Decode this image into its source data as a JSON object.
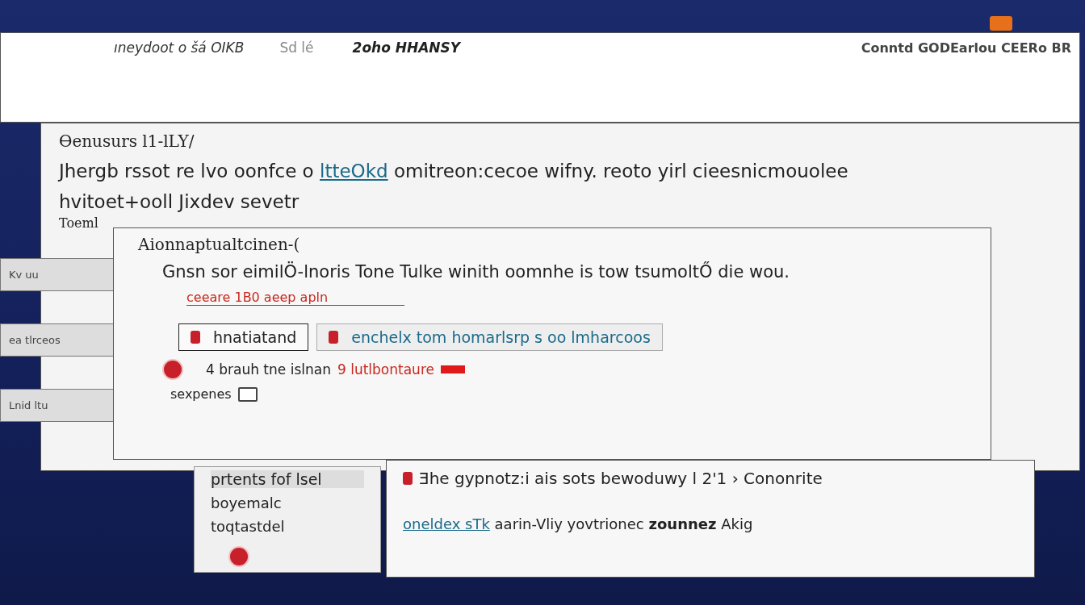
{
  "top_window": {
    "title": "ıneydoot o šá OIKB",
    "tabs": [
      {
        "label": "Sd lé",
        "selected": false
      },
      {
        "label": "2oho HHANSY",
        "selected": true
      }
    ],
    "right_text": "Conntd GODEarlou CEERo BR"
  },
  "main_window": {
    "heading": "Ɵenusurs l1-lLY/",
    "line_1_before": "Jhergb rssot re lvo oonfce o",
    "line_1_link": "ltteOkd",
    "line_1_after": "omitreon:cecoe wifny. reoto yirl cieesnicmouolee",
    "line_2": "hvitoet+ooll Jixdev sevetr",
    "line_3": "Toeml"
  },
  "dialog": {
    "title": "Aionnaptualtcinen-(",
    "body": "Gnsn sor eimilÖ-lnoris Tone Tulke winith oomnhe is tow tsumoltŐ die wou.",
    "warning": "ceeare 1B0 aeep apln",
    "tabs": [
      {
        "label": "hnatiatand",
        "selected": true
      },
      {
        "label": "enchelx tom homarlsrp s oo lmharcoos",
        "selected": false
      }
    ],
    "alert_before": "4 brauh tne islnan",
    "alert_red": "9 lutlbontaure",
    "option": {
      "label": "sexpenes",
      "checked": false
    }
  },
  "side_panels": [
    {
      "text": "Kv uu"
    },
    {
      "text": "ea tlrceos"
    },
    {
      "text": "Lnid ltu"
    }
  ],
  "card": {
    "title": "prtents fof lsel",
    "line_1": "boyemalc",
    "line_2": "toqtastdel"
  },
  "bottom_dialog": {
    "title": "Ǝhe gypnotz:i ais sots bewoduwy l 2'1 › Cononrite",
    "link": "oneldex sTk",
    "text": "aarin-Vliy yovtrionec",
    "bold": "zounnez",
    "tail": "Akig"
  }
}
